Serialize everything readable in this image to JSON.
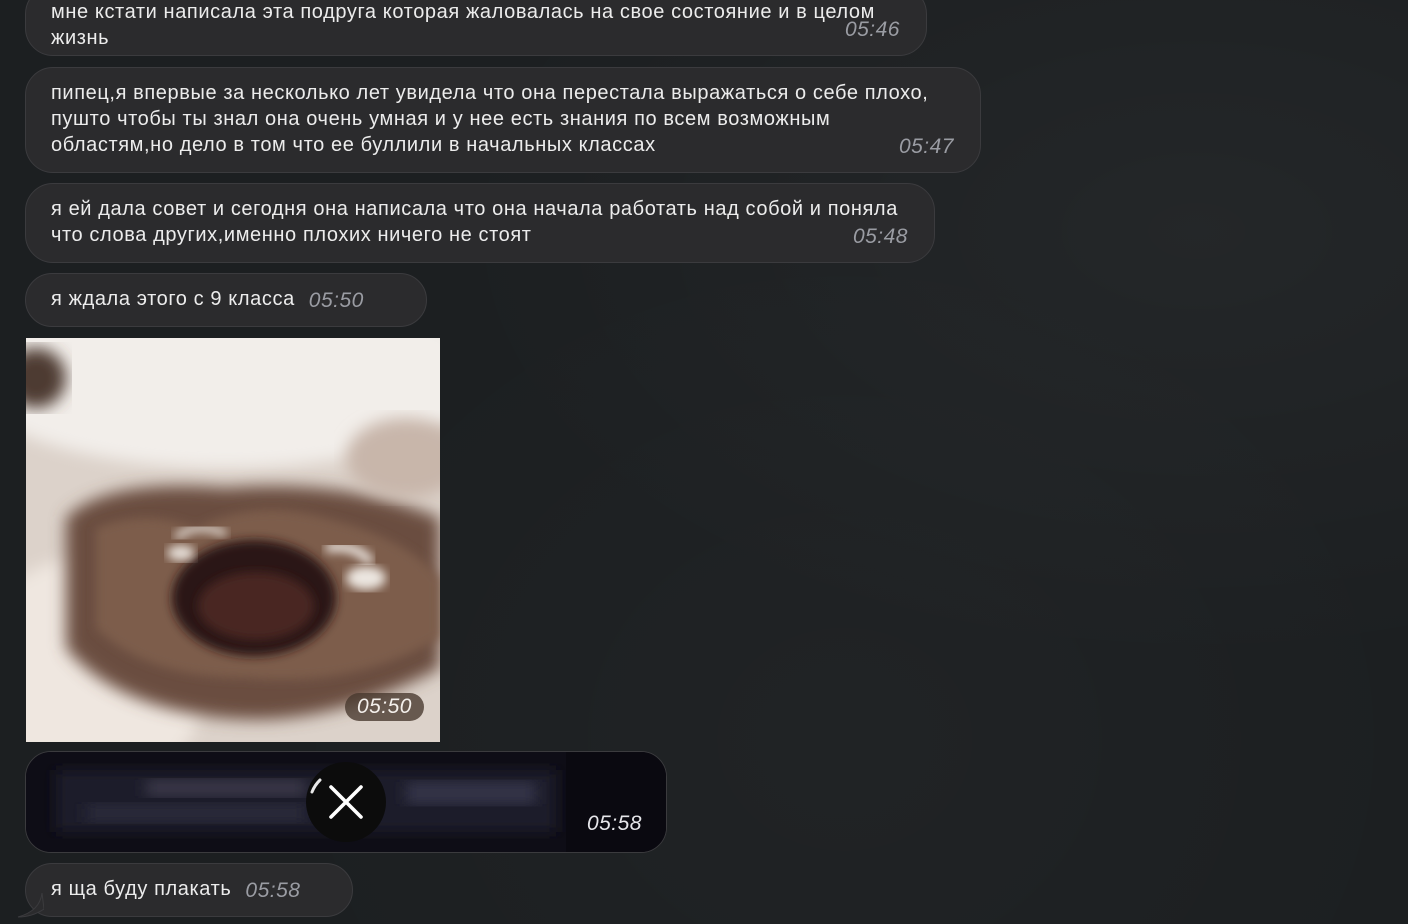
{
  "messages": [
    {
      "text": "мне кстати написала эта подруга которая жаловалась на свое состояние и в целом жизнь",
      "time": "05:46"
    },
    {
      "text": "пипец,я впервые за несколько лет увидела что она перестала выражаться о себе плохо, пушто чтобы ты знал она очень умная и у нее есть знания по всем возможным областям,но дело в том что ее буллили в начальных классах",
      "time": "05:47"
    },
    {
      "text": "я ей дала совет и сегодня она написала что она начала работать над собой и поняла что слова других,именно плохих ничего не стоят",
      "time": "05:48"
    },
    {
      "text": "я ждала этого с 9 класса",
      "time": "05:50"
    },
    {
      "type": "image",
      "time": "05:50"
    },
    {
      "type": "video",
      "time": "05:58",
      "icon": "close-icon"
    },
    {
      "text": "я ща буду плакать",
      "time": "05:58"
    }
  ],
  "colors": {
    "background": "#1c1f21",
    "bubble": "#2b2b2d",
    "bubble_border": "#3b3b3e",
    "text": "#ececec",
    "time": "#9a9ca3"
  }
}
